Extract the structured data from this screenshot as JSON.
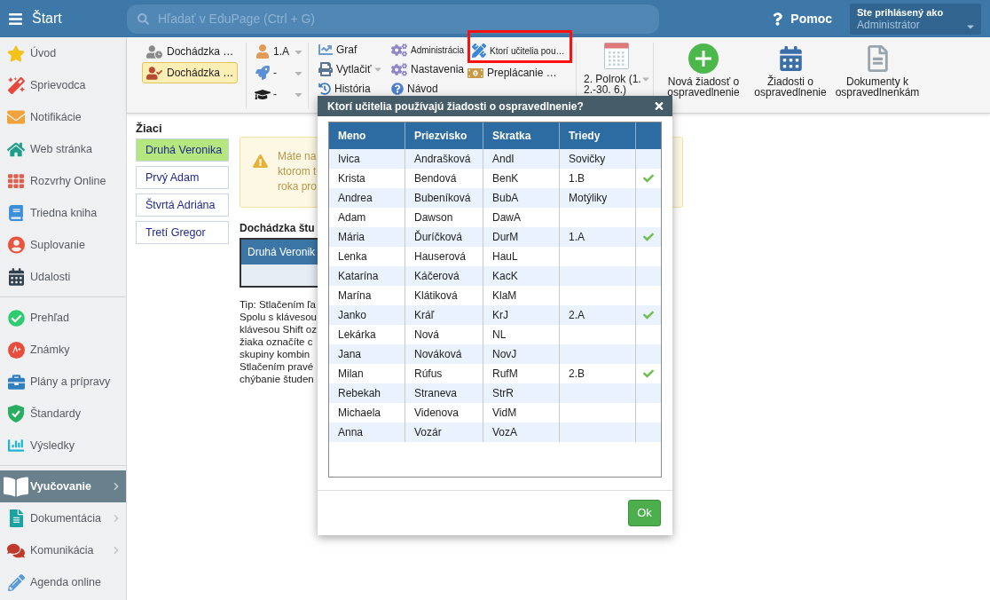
{
  "top_bar": {
    "title": "Štart",
    "search": {
      "placeholder": "Hľadať v EduPage (Ctrl + G)"
    },
    "help": "Pomoc",
    "account": {
      "caption": "Ste prihlásený ako",
      "user": "Administrátor"
    }
  },
  "sidebar": {
    "sections": [
      {
        "items": [
          {
            "label": "Úvod",
            "selected": false,
            "submenu": false
          },
          {
            "label": "Sprievodca",
            "selected": false,
            "submenu": false
          },
          {
            "label": "Notifikácie",
            "selected": false,
            "submenu": false
          },
          {
            "label": "Web stránka",
            "selected": false,
            "submenu": false
          },
          {
            "label": "Rozvrhy Online",
            "selected": false,
            "submenu": false
          },
          {
            "label": "Triedna kniha",
            "selected": false,
            "submenu": false
          },
          {
            "label": "Suplovanie",
            "selected": false,
            "submenu": false
          },
          {
            "label": "Udalosti",
            "selected": false,
            "submenu": false
          }
        ]
      },
      {
        "items": [
          {
            "label": "Prehľad",
            "selected": false,
            "submenu": false
          },
          {
            "label": "Známky",
            "selected": false,
            "submenu": false
          },
          {
            "label": "Plány a prípravy",
            "selected": false,
            "submenu": false
          },
          {
            "label": "Štandardy",
            "selected": false,
            "submenu": false
          },
          {
            "label": "Výsledky",
            "selected": false,
            "submenu": false
          }
        ]
      },
      {
        "items": [
          {
            "label": "Vyučovanie",
            "selected": true,
            "submenu": true
          },
          {
            "label": "Dokumentácia",
            "selected": false,
            "submenu": true
          },
          {
            "label": "Komunikácia",
            "selected": false,
            "submenu": true
          },
          {
            "label": "Agenda online",
            "selected": false,
            "submenu": false
          }
        ]
      }
    ]
  },
  "toolbar": {
    "views": [
      {
        "label": "Dochádzka …",
        "selected": false
      },
      {
        "label": "Dochádzka …",
        "selected": true
      }
    ],
    "filters": [
      {
        "value": "1.A"
      },
      {
        "value": "-"
      },
      {
        "value": "-"
      }
    ],
    "tool_columns": [
      [
        {
          "label": "Graf"
        },
        {
          "label": "Vytlačiť",
          "menu": true
        },
        {
          "label": "História"
        }
      ],
      [
        {
          "label": "Administrácia"
        },
        {
          "label": "Nastavenia"
        },
        {
          "label": "Návod"
        }
      ],
      [
        {
          "label": "Ktorí učitelia pou…",
          "highlighted": true
        },
        {
          "label": "Preplácanie …"
        }
      ]
    ],
    "period": {
      "label": "2. Polrok (1. 2.-30. 6.)"
    },
    "actions": [
      {
        "label": "Nová žiadosť o ospravedlnenie"
      },
      {
        "label": "Žiadosti o ospravedlnenie"
      },
      {
        "label": "Dokumenty k ospravedlnenkám"
      }
    ]
  },
  "students": {
    "title": "Žiaci",
    "items": [
      {
        "name": "Druhá Veronika",
        "selected": true
      },
      {
        "name": "Prvý Adam",
        "selected": false
      },
      {
        "name": "Štvrtá Adriána",
        "selected": false
      },
      {
        "name": "Tretí Gregor",
        "selected": false
      }
    ]
  },
  "notice": {
    "lines": [
      "Máte na",
      "ktorom t",
      "roka pro"
    ]
  },
  "attendance": {
    "title": "Dochádzka štu",
    "header": "Druhá Veronik"
  },
  "tip": {
    "lines": [
      "Tip: Stlačením ľa",
      "Spolu s klávesou",
      "klávesou Shift oz",
      "žiaka označíte c",
      "skupiny kombin",
      "Stlačením pravé",
      "chýbanie študen"
    ]
  },
  "dialog": {
    "title": "Ktorí učitelia používajú žiadosti o ospravedlnenie?",
    "columns": [
      "Meno",
      "Priezvisko",
      "Skratka",
      "Triedy"
    ],
    "rows": [
      {
        "first_name": "Ivica",
        "last_name": "Andrašková",
        "short": "AndI",
        "classes": "Sovičky",
        "checked": false
      },
      {
        "first_name": "Krista",
        "last_name": "Bendová",
        "short": "BenK",
        "classes": "1.B",
        "checked": true
      },
      {
        "first_name": "Andrea",
        "last_name": "Bubeníková",
        "short": "BubA",
        "classes": "Motýliky",
        "checked": false
      },
      {
        "first_name": "Adam",
        "last_name": "Dawson",
        "short": "DawA",
        "checked": false
      },
      {
        "first_name": "Mária",
        "last_name": "Ďuríčková",
        "short": "DurM",
        "classes": "1.A",
        "checked": true
      },
      {
        "first_name": "Lenka",
        "last_name": "Hauserová",
        "short": "HauL",
        "checked": false
      },
      {
        "first_name": "Katarína",
        "last_name": "Káčerová",
        "short": "KacK",
        "checked": false
      },
      {
        "first_name": "Marína",
        "last_name": "Klátiková",
        "short": "KlaM",
        "checked": false
      },
      {
        "first_name": "Janko",
        "last_name": "Kráľ",
        "short": "KrJ",
        "classes": "2.A",
        "checked": true
      },
      {
        "first_name": "Lekárka",
        "last_name": "Nová",
        "short": "NL",
        "checked": false
      },
      {
        "first_name": "Jana",
        "last_name": "Nováková",
        "short": "NovJ",
        "checked": false
      },
      {
        "first_name": "Milan",
        "last_name": "Rúfus",
        "short": "RufM",
        "classes": "2.B",
        "checked": true
      },
      {
        "first_name": "Rebekah",
        "last_name": "Straneva",
        "short": "StrR",
        "checked": false
      },
      {
        "first_name": "Michaela",
        "last_name": "Videnova",
        "short": "VidM",
        "checked": false
      },
      {
        "first_name": "Anna",
        "last_name": "Vozár",
        "short": "VozA",
        "checked": false
      }
    ],
    "button": "Ok"
  }
}
